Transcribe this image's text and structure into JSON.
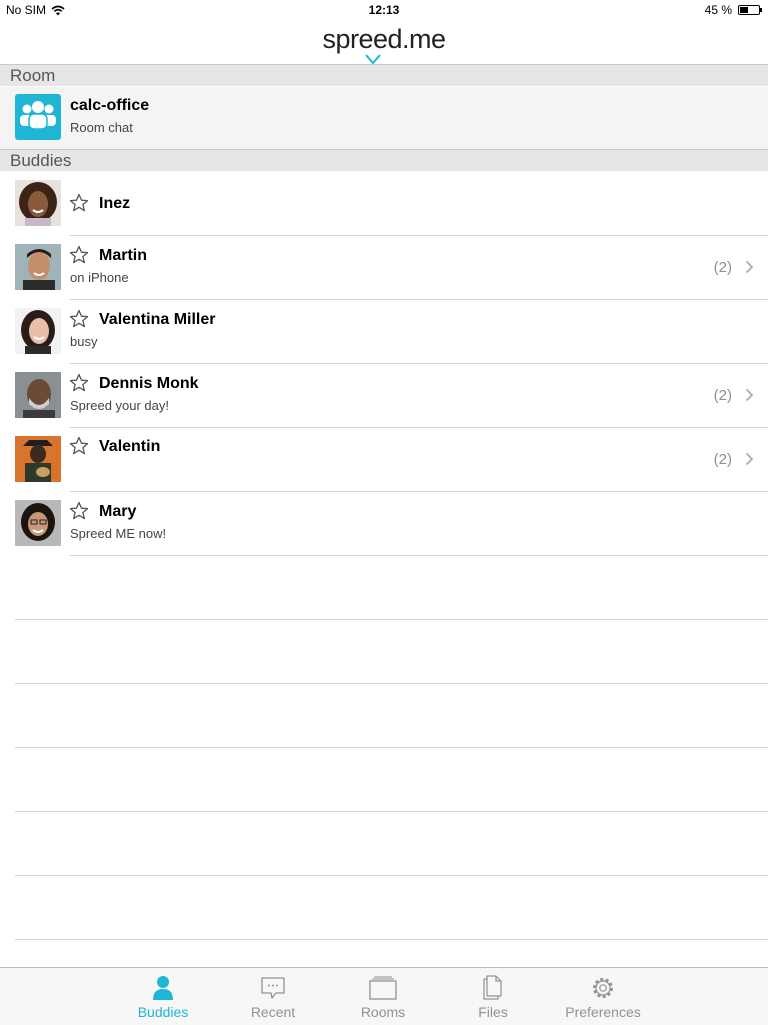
{
  "status_bar": {
    "carrier": "No SIM",
    "time": "12:13",
    "battery": "45 %",
    "battery_level": 0.45
  },
  "header": {
    "logo": "spreed.me"
  },
  "room_section": {
    "title": "Room",
    "room": {
      "name": "calc-office",
      "subtitle": "Room chat"
    }
  },
  "buddies_section": {
    "title": "Buddies",
    "buddies": [
      {
        "name": "Inez",
        "status": "",
        "count": ""
      },
      {
        "name": "Martin",
        "status": "on iPhone",
        "count": "(2)"
      },
      {
        "name": "Valentina Miller",
        "status": "busy",
        "count": ""
      },
      {
        "name": "Dennis Monk",
        "status": "Spreed your day!",
        "count": "(2)"
      },
      {
        "name": "Valentin",
        "status": "",
        "count": "(2)"
      },
      {
        "name": "Mary",
        "status": "Spreed ME now!",
        "count": ""
      }
    ]
  },
  "tabbar": {
    "tabs": [
      {
        "label": "Buddies",
        "icon": "person-icon",
        "active": true
      },
      {
        "label": "Recent",
        "icon": "chat-bubble-icon",
        "active": false
      },
      {
        "label": "Rooms",
        "icon": "rooms-icon",
        "active": false
      },
      {
        "label": "Files",
        "icon": "files-icon",
        "active": false
      },
      {
        "label": "Preferences",
        "icon": "gear-icon",
        "active": false
      }
    ]
  },
  "colors": {
    "accent": "#1fb5d4",
    "section_bg": "#e6e6e6",
    "count_gray": "#8e8e93"
  }
}
